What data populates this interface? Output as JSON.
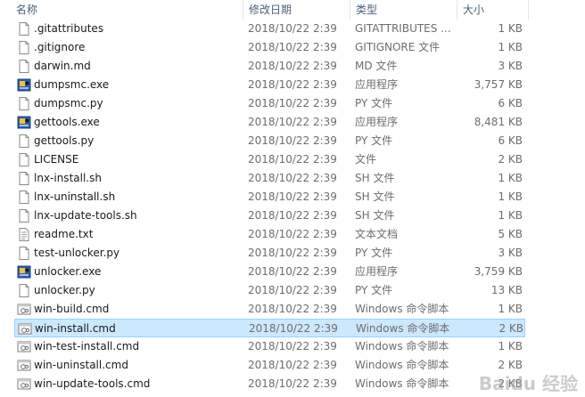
{
  "header": {
    "name": "名称",
    "date": "修改日期",
    "type": "类型",
    "size": "大小"
  },
  "files": [
    {
      "name": ".gitattributes",
      "date": "2018/10/22 2:39",
      "type": "GITATTRIBUTES ...",
      "size": "1 KB",
      "icon": "file-icon"
    },
    {
      "name": ".gitignore",
      "date": "2018/10/22 2:39",
      "type": "GITIGNORE 文件",
      "size": "1 KB",
      "icon": "file-icon"
    },
    {
      "name": "darwin.md",
      "date": "2018/10/22 2:39",
      "type": "MD 文件",
      "size": "3 KB",
      "icon": "file-icon"
    },
    {
      "name": "dumpsmc.exe",
      "date": "2018/10/22 2:39",
      "type": "应用程序",
      "size": "3,757 KB",
      "icon": "exe-icon"
    },
    {
      "name": "dumpsmc.py",
      "date": "2018/10/22 2:39",
      "type": "PY 文件",
      "size": "6 KB",
      "icon": "file-icon"
    },
    {
      "name": "gettools.exe",
      "date": "2018/10/22 2:39",
      "type": "应用程序",
      "size": "8,481 KB",
      "icon": "exe-icon"
    },
    {
      "name": "gettools.py",
      "date": "2018/10/22 2:39",
      "type": "PY 文件",
      "size": "6 KB",
      "icon": "file-icon"
    },
    {
      "name": "LICENSE",
      "date": "2018/10/22 2:39",
      "type": "文件",
      "size": "2 KB",
      "icon": "file-icon"
    },
    {
      "name": "lnx-install.sh",
      "date": "2018/10/22 2:39",
      "type": "SH 文件",
      "size": "1 KB",
      "icon": "file-icon"
    },
    {
      "name": "lnx-uninstall.sh",
      "date": "2018/10/22 2:39",
      "type": "SH 文件",
      "size": "1 KB",
      "icon": "file-icon"
    },
    {
      "name": "lnx-update-tools.sh",
      "date": "2018/10/22 2:39",
      "type": "SH 文件",
      "size": "1 KB",
      "icon": "file-icon"
    },
    {
      "name": "readme.txt",
      "date": "2018/10/22 2:39",
      "type": "文本文档",
      "size": "5 KB",
      "icon": "text-file-icon"
    },
    {
      "name": "test-unlocker.py",
      "date": "2018/10/22 2:39",
      "type": "PY 文件",
      "size": "3 KB",
      "icon": "file-icon"
    },
    {
      "name": "unlocker.exe",
      "date": "2018/10/22 2:39",
      "type": "应用程序",
      "size": "3,759 KB",
      "icon": "exe-icon"
    },
    {
      "name": "unlocker.py",
      "date": "2018/10/22 2:39",
      "type": "PY 文件",
      "size": "13 KB",
      "icon": "file-icon"
    },
    {
      "name": "win-build.cmd",
      "date": "2018/10/22 2:39",
      "type": "Windows 命令脚本",
      "size": "1 KB",
      "icon": "cmd-icon"
    },
    {
      "name": "win-install.cmd",
      "date": "2018/10/22 2:39",
      "type": "Windows 命令脚本",
      "size": "2 KB",
      "icon": "cmd-icon",
      "selected": true
    },
    {
      "name": "win-test-install.cmd",
      "date": "2018/10/22 2:39",
      "type": "Windows 命令脚本",
      "size": "1 KB",
      "icon": "cmd-icon"
    },
    {
      "name": "win-uninstall.cmd",
      "date": "2018/10/22 2:39",
      "type": "Windows 命令脚本",
      "size": "2 KB",
      "icon": "cmd-icon"
    },
    {
      "name": "win-update-tools.cmd",
      "date": "2018/10/22 2:39",
      "type": "Windows 命令脚本",
      "size": "2 KB",
      "icon": "cmd-icon"
    }
  ],
  "watermark": "Baidu 经验",
  "colors": {
    "selection_bg": "#cce8ff",
    "selection_border": "#99d1ff",
    "header_text": "#4c607a",
    "secondary_text": "#6d6d6d"
  }
}
